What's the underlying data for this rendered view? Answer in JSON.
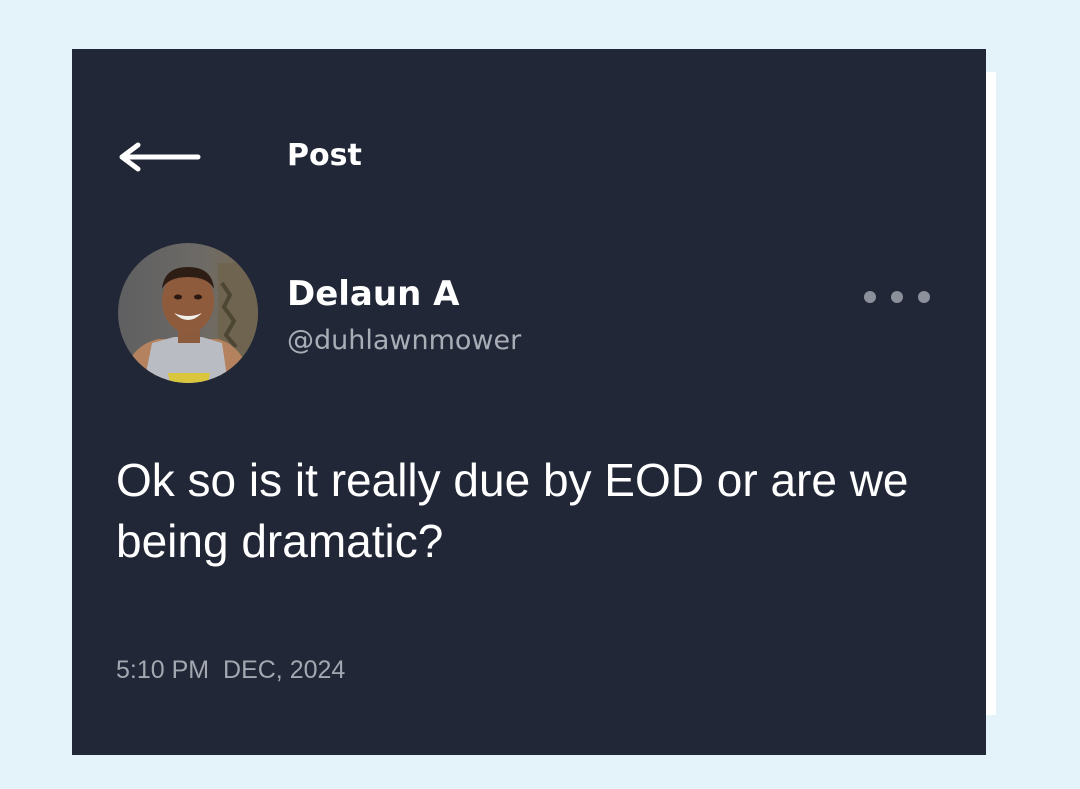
{
  "header": {
    "back_icon": "left-arrow-icon",
    "title": "Post"
  },
  "author": {
    "display_name": "Delaun A",
    "handle": "@duhlawnmower",
    "avatar": "profile-photo"
  },
  "more_icon": "more-horizontal-icon",
  "post": {
    "text": "Ok so is it really due by EOD or are we being dramatic?",
    "time": "5:10 PM",
    "date": "DEC, 2024"
  },
  "colors": {
    "page_background": "#e3f3f9",
    "card_background": "#212737",
    "primary_text": "#ffffff",
    "secondary_text": "#a9adb6"
  }
}
